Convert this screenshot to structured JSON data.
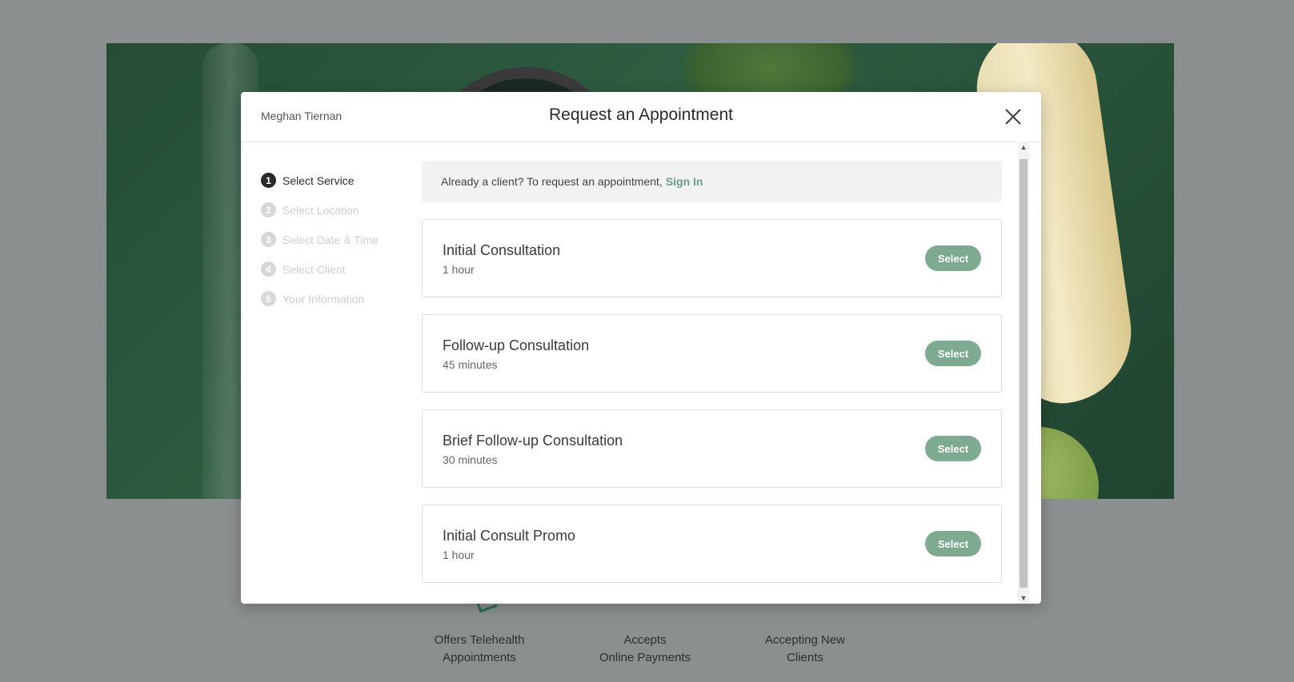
{
  "background": {
    "features": [
      {
        "line1": "Offers Telehealth",
        "line2": "Appointments"
      },
      {
        "line1": "Accepts",
        "line2": "Online Payments"
      },
      {
        "line1": "Accepting New",
        "line2": "Clients"
      }
    ]
  },
  "modal": {
    "provider_name": "Meghan Tiernan",
    "title": "Request an Appointment",
    "close_icon": "close-icon",
    "steps": [
      {
        "number": "1",
        "label": "Select Service",
        "state": "active"
      },
      {
        "number": "2",
        "label": "Select Location",
        "state": "inactive"
      },
      {
        "number": "3",
        "label": "Select Date & Time",
        "state": "inactive"
      },
      {
        "number": "4",
        "label": "Select Client",
        "state": "inactive"
      },
      {
        "number": "5",
        "label": "Your Information",
        "state": "inactive"
      }
    ],
    "signin": {
      "text": "Already a client? To request an appointment,",
      "link": "Sign In"
    },
    "services": [
      {
        "name": "Initial Consultation",
        "duration": "1 hour",
        "button": "Select"
      },
      {
        "name": "Follow-up Consultation",
        "duration": "45 minutes",
        "button": "Select"
      },
      {
        "name": "Brief Follow-up Consultation",
        "duration": "30 minutes",
        "button": "Select"
      },
      {
        "name": "Initial Consult Promo",
        "duration": "1 hour",
        "button": "Select"
      }
    ]
  },
  "colors": {
    "accent": "#7eaa92",
    "link": "#6c9e84",
    "overlay": "#8b8f8f"
  }
}
